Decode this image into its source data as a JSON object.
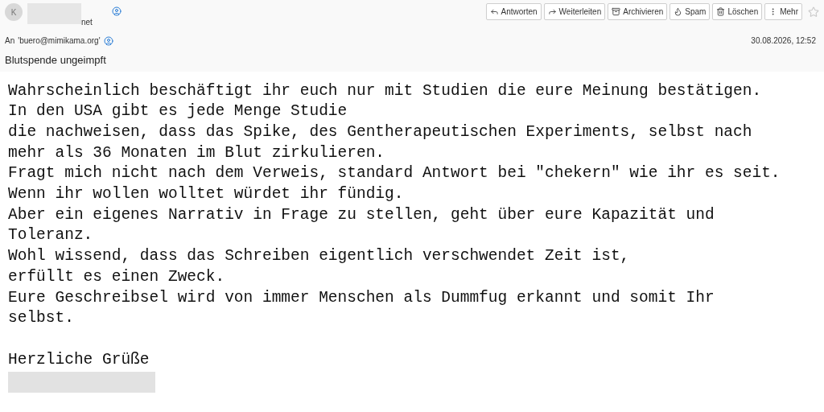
{
  "header": {
    "avatar_initial": "K",
    "sender_suffix": "net",
    "to_label": "An",
    "recipient": "'buero@mimikama.org'",
    "date": "30.08.2026, 12:52",
    "subject": "Blutspende ungeimpft",
    "buttons": [
      {
        "kind": "reply",
        "label": "Antworten"
      },
      {
        "kind": "forward",
        "label": "Weiterleiten"
      },
      {
        "kind": "archive",
        "label": "Archivieren"
      },
      {
        "kind": "spam",
        "label": "Spam"
      },
      {
        "kind": "delete",
        "label": "Löschen"
      },
      {
        "kind": "more",
        "label": "Mehr"
      }
    ]
  },
  "body": {
    "lines": [
      "Wahrscheinlich beschäftigt ihr euch nur mit Studien die eure Meinung bestätigen.",
      "In den USA gibt es jede Menge Studie",
      "die nachweisen, dass das Spike, des Gentherapeutischen Experiments, selbst nach",
      "mehr als 36 Monaten im Blut zirkulieren.",
      "Fragt mich nicht nach dem Verweis, standard Antwort bei \"chekern\" wie ihr es seit.",
      "Wenn ihr wollen wolltet würdet ihr fündig.",
      "Aber ein eigenes Narrativ in Frage zu stellen, geht über eure Kapazität und",
      "Toleranz.",
      "Wohl wissend, dass das Schreiben eigentlich verschwendet Zeit ist,",
      "erfüllt es einen Zweck.",
      "Eure Geschreibsel wird von immer Menschen als Dummfug erkannt und somit Ihr",
      "selbst."
    ],
    "signoff": "Herzliche Grüße"
  }
}
